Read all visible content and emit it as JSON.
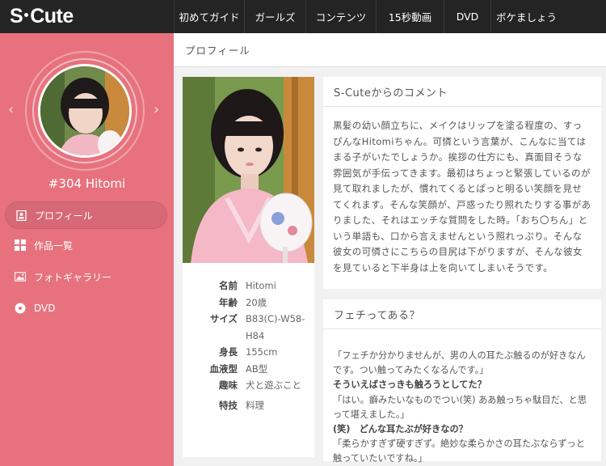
{
  "brand": {
    "name_left": "S",
    "name_right": "Cute"
  },
  "nav": [
    "初めてガイド",
    "ガールズ",
    "コンテンツ",
    "15秒動画",
    "DVD",
    "ボケましょう"
  ],
  "sidebar": {
    "profile_name": "#304 Hitomi",
    "prev_arrow": "‹",
    "next_arrow": "›",
    "items": [
      {
        "label": "プロフィール",
        "icon": "profile-icon",
        "active": true
      },
      {
        "label": "作品一覧",
        "icon": "grid-icon",
        "active": false
      },
      {
        "label": "フォトギャラリー",
        "icon": "photo-icon",
        "active": false
      },
      {
        "label": "DVD",
        "icon": "disc-icon",
        "active": false
      }
    ]
  },
  "breadcrumb": "プロフィール",
  "specs": [
    {
      "key": "名前",
      "value": "Hitomi"
    },
    {
      "key": "年齢",
      "value": "20歳"
    },
    {
      "key": "サイズ",
      "value": "B83(C)-W58-H84"
    },
    {
      "key": "身長",
      "value": "155cm"
    },
    {
      "key": "血液型",
      "value": "AB型"
    },
    {
      "key": "趣味",
      "value": "犬と遊ぶこと"
    },
    {
      "key": "特技",
      "value": "料理"
    }
  ],
  "comment": {
    "title": "S-Cuteからのコメント",
    "body": "黒髪の幼い顔立ちに、メイクはリップを塗る程度の、すっぴんなHitomiちゃん。可憐という言葉が、こんなに当てはまる子がいたでしょうか。挨拶の仕方にも、真面目そうな雰囲気が手伝ってきます。最初はちょっと緊張しているのが見て取れましたが、慣れてくるとぱっと明るい笑顔を見せてくれます。そんな笑顔が、戸惑ったり照れたりする事がありました、それはエッチな質問をした時。「おち〇ちん」という単語も、口から言えませんという照れっぷり。そんな彼女の可憐さにこちらの目尻は下がりますが、そんな彼女を見ていると下半身は上を向いてしまいそうです。"
  },
  "fetish": {
    "title": "フェチってある？",
    "lines": [
      {
        "text": "「フェチか分かりませんが、男の人の耳たぶ触るのが好きなんです。つい触ってみたくなるんです。」",
        "bold": false
      },
      {
        "text": "そういえばさっきも触ろうとしてた？",
        "bold": true
      },
      {
        "text": "「はい。癖みたいなものでつい(笑) ああ触っちゃ駄目だ、と思って堪えました。」",
        "bold": false
      },
      {
        "text": "(笑)　どんな耳たぶが好きなの？",
        "bold": true
      },
      {
        "text": "「柔らかすぎず硬すぎず。絶妙な柔らかさの耳たぶならずっと触っていたいですね。」",
        "bold": false
      }
    ]
  },
  "colors": {
    "sidebar": "#e7727e",
    "topbar": "#242424"
  }
}
